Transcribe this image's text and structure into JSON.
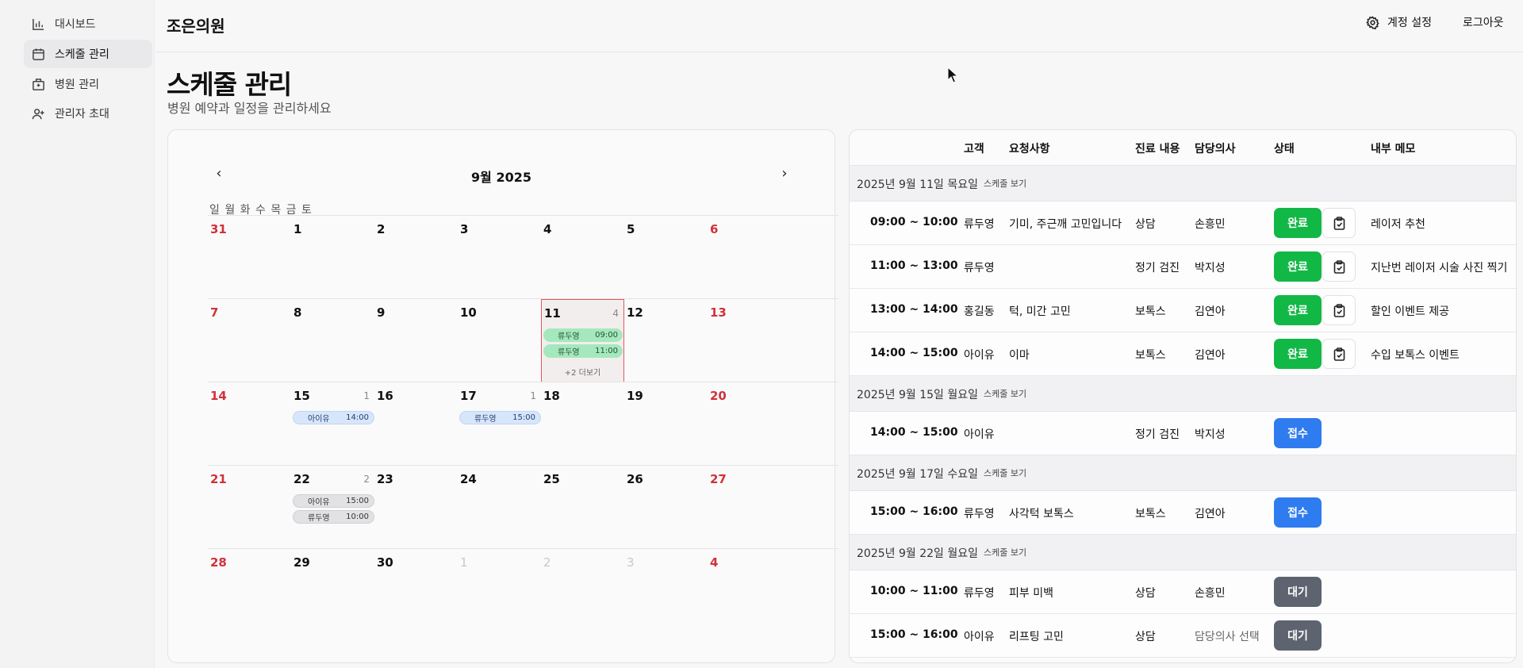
{
  "sidebar": {
    "items": [
      {
        "label": "대시보드",
        "icon": "bar-chart-icon",
        "active": false
      },
      {
        "label": "스케줄 관리",
        "icon": "calendar-icon",
        "active": true
      },
      {
        "label": "병원 관리",
        "icon": "hospital-icon",
        "active": false
      },
      {
        "label": "관리자 초대",
        "icon": "user-plus-icon",
        "active": false
      }
    ]
  },
  "header": {
    "app_title": "조은의원",
    "account_settings": "계정 설정",
    "logout": "로그아웃"
  },
  "page": {
    "title": "스케줄 관리",
    "subtitle": "병원 예약과 일정을 관리하세요"
  },
  "calendar": {
    "month_label": "9월 2025",
    "weekday_header": "일 월 화 수 목 금 토",
    "prev_icon": "chevron-left-icon",
    "next_icon": "chevron-right-icon",
    "weeks": [
      [
        {
          "d": "31",
          "t": "sun"
        },
        {
          "d": "1"
        },
        {
          "d": "2"
        },
        {
          "d": "3"
        },
        {
          "d": "4"
        },
        {
          "d": "5"
        },
        {
          "d": "6",
          "t": "sat"
        }
      ],
      [
        {
          "d": "7",
          "t": "sun"
        },
        {
          "d": "8"
        },
        {
          "d": "9"
        },
        {
          "d": "10"
        },
        {
          "d": "11",
          "count": "4",
          "selected": true
        },
        {
          "d": "12"
        },
        {
          "d": "13",
          "t": "sat"
        }
      ],
      [
        {
          "d": "14",
          "t": "sun"
        },
        {
          "d": "15",
          "count": "1"
        },
        {
          "d": "16"
        },
        {
          "d": "17",
          "count": "1"
        },
        {
          "d": "18"
        },
        {
          "d": "19"
        },
        {
          "d": "20",
          "t": "sat"
        }
      ],
      [
        {
          "d": "21",
          "t": "sun"
        },
        {
          "d": "22",
          "count": "2"
        },
        {
          "d": "23"
        },
        {
          "d": "24"
        },
        {
          "d": "25"
        },
        {
          "d": "26"
        },
        {
          "d": "27",
          "t": "sat"
        }
      ],
      [
        {
          "d": "28",
          "t": "sun"
        },
        {
          "d": "29"
        },
        {
          "d": "30"
        },
        {
          "d": "1",
          "t": "dim"
        },
        {
          "d": "2",
          "t": "dim"
        },
        {
          "d": "3",
          "t": "dim"
        },
        {
          "d": "4",
          "t": "sat"
        }
      ]
    ],
    "events": {
      "day11": [
        {
          "name": "류두영",
          "time": "09:00"
        },
        {
          "name": "류두영",
          "time": "11:00"
        }
      ],
      "day11_more": "+2 더보기",
      "day15": [
        {
          "name": "아이유",
          "time": "14:00"
        }
      ],
      "day17": [
        {
          "name": "류두영",
          "time": "15:00"
        }
      ],
      "day22": [
        {
          "name": "아이유",
          "time": "15:00"
        },
        {
          "name": "류두영",
          "time": "10:00"
        }
      ]
    }
  },
  "table": {
    "headers": {
      "customer": "고객",
      "request": "요청사항",
      "treatment": "진료 내용",
      "doctor": "담당의사",
      "status": "상태",
      "memo": "내부 메모"
    },
    "view_link": "스케줄 보기",
    "groups": [
      {
        "date": "2025년 9월 11일 목요일",
        "rows": [
          {
            "time": "09:00 ~ 10:00",
            "customer": "류두영",
            "request": "기미, 주근깨 고민입니다",
            "treatment": "상담",
            "doctor": "손흥민",
            "status": "완료",
            "memo": "레이저 추천"
          },
          {
            "time": "11:00 ~ 13:00",
            "customer": "류두영",
            "request": "",
            "treatment": "정기 검진",
            "doctor": "박지성",
            "status": "완료",
            "memo": "지난번 레이저 시술 사진 찍기"
          },
          {
            "time": "13:00 ~ 14:00",
            "customer": "홍길동",
            "request": "턱, 미간 고민",
            "treatment": "보톡스",
            "doctor": "김연아",
            "status": "완료",
            "memo": "할인 이벤트 제공"
          },
          {
            "time": "14:00 ~ 15:00",
            "customer": "아이유",
            "request": "이마",
            "treatment": "보톡스",
            "doctor": "김연아",
            "status": "완료",
            "memo": "수입 보톡스 이벤트"
          }
        ]
      },
      {
        "date": "2025년 9월 15일 월요일",
        "rows": [
          {
            "time": "14:00 ~ 15:00",
            "customer": "아이유",
            "request": "",
            "treatment": "정기 검진",
            "doctor": "박지성",
            "status": "접수",
            "memo": ""
          }
        ]
      },
      {
        "date": "2025년 9월 17일 수요일",
        "rows": [
          {
            "time": "15:00 ~ 16:00",
            "customer": "류두영",
            "request": "사각턱 보톡스",
            "treatment": "보톡스",
            "doctor": "김연아",
            "status": "접수",
            "memo": ""
          }
        ]
      },
      {
        "date": "2025년 9월 22일 월요일",
        "rows": [
          {
            "time": "10:00 ~ 11:00",
            "customer": "류두영",
            "request": "피부 미백",
            "treatment": "상담",
            "doctor": "손흥민",
            "status": "대기",
            "memo": ""
          },
          {
            "time": "15:00 ~ 16:00",
            "customer": "아이유",
            "request": "리프팅 고민",
            "treatment": "상담",
            "doctor": "담당의사 선택",
            "status": "대기",
            "memo": ""
          }
        ]
      }
    ]
  },
  "colors": {
    "done": "#12b845",
    "received": "#2f7bf0",
    "waiting": "#5d6470",
    "weekend": "#d0323a"
  }
}
